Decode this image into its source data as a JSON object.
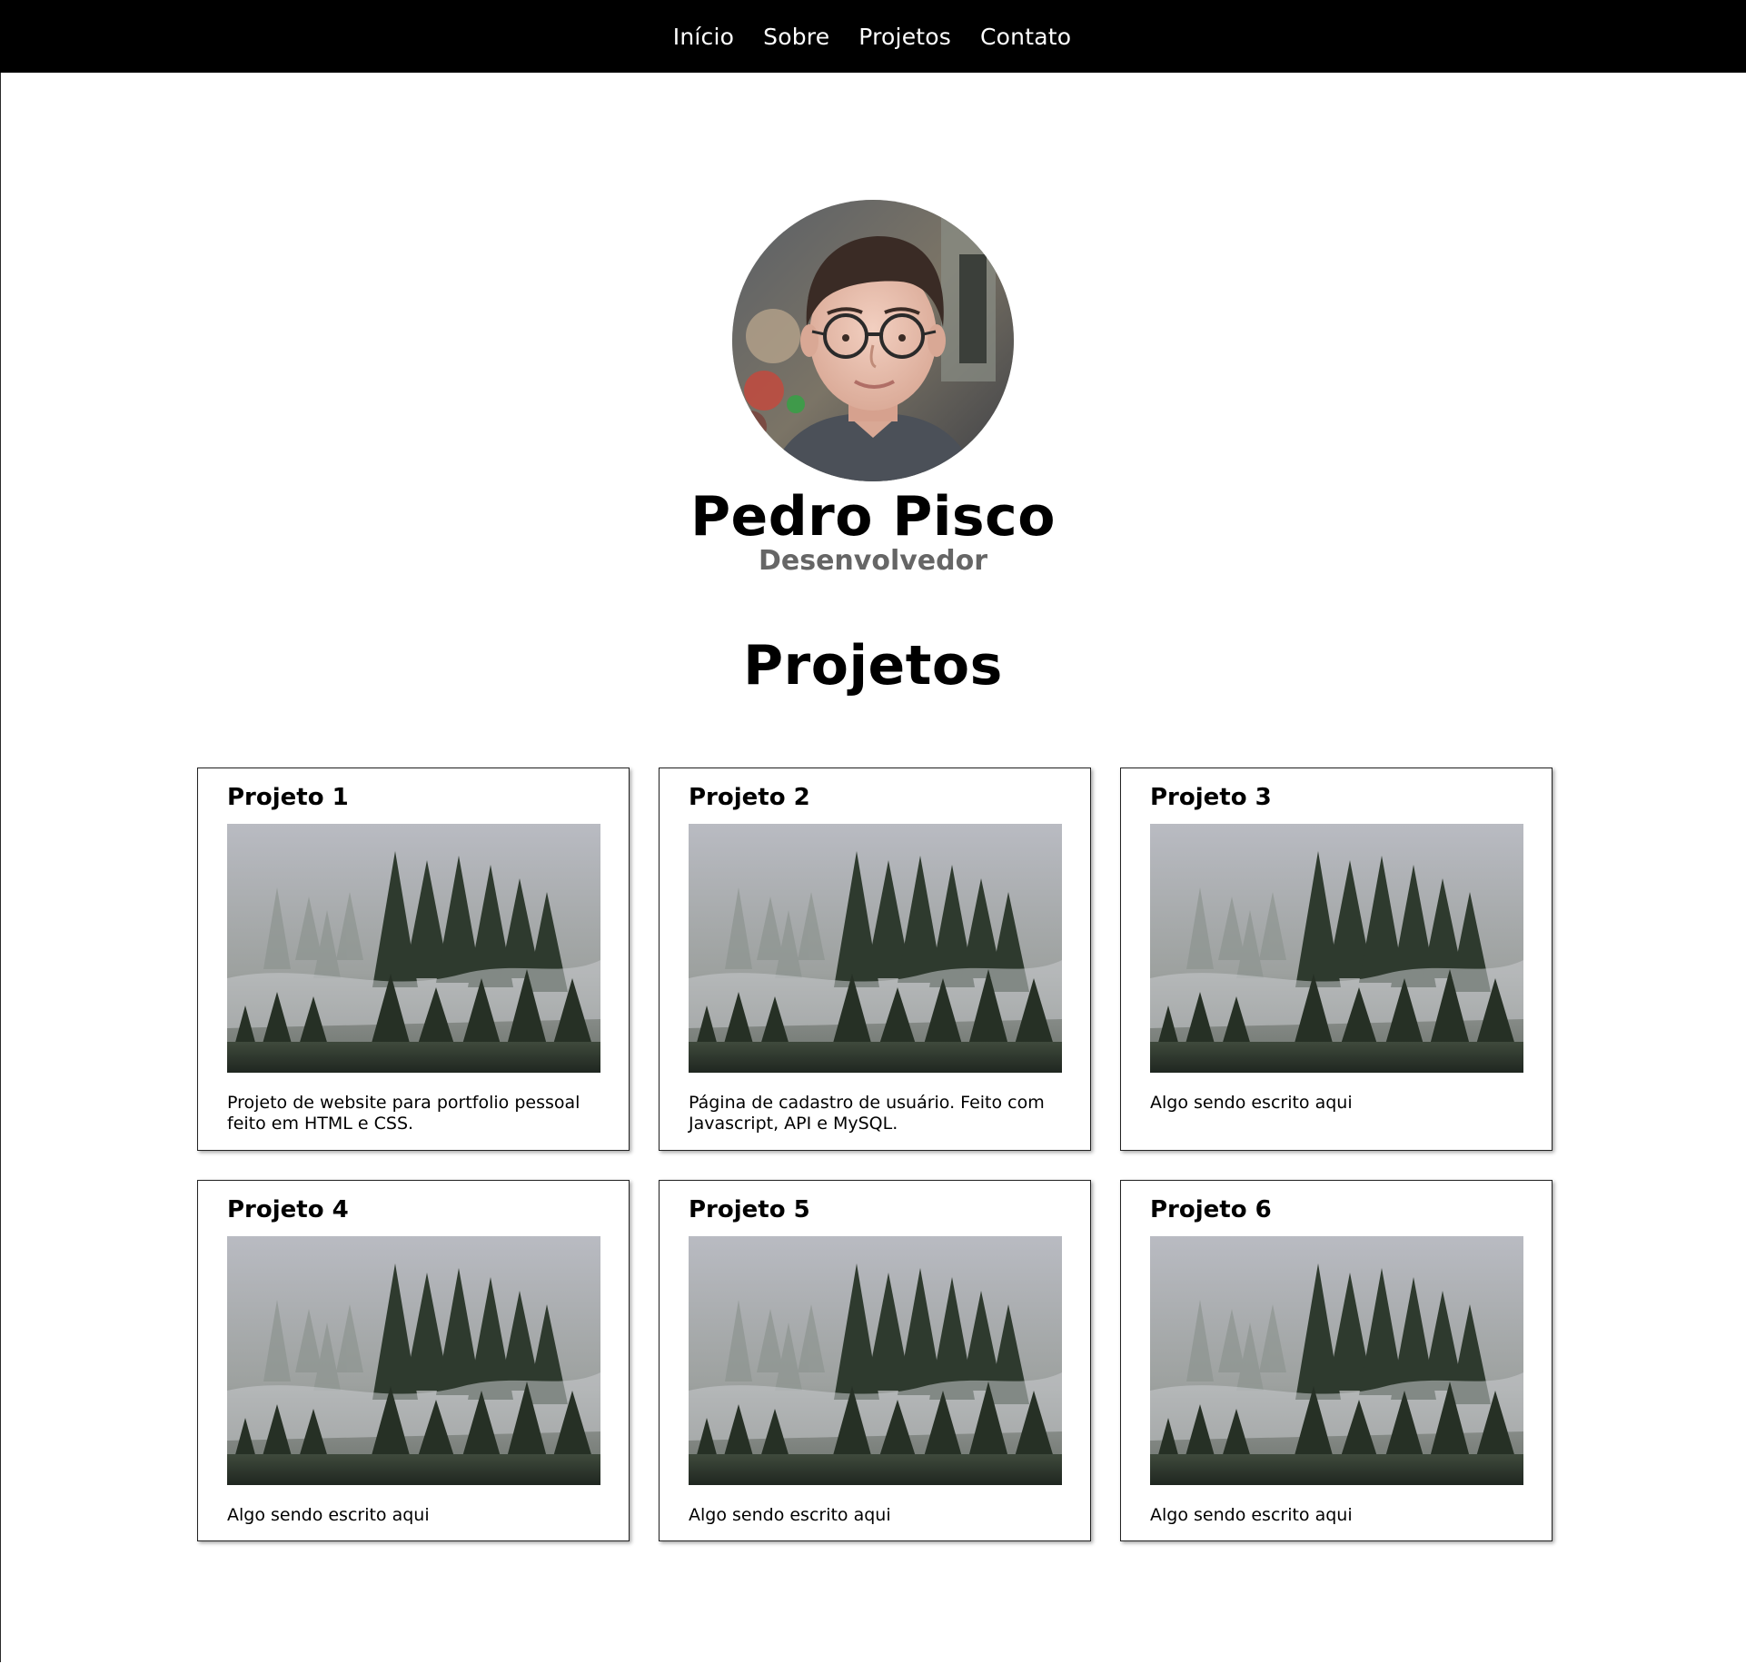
{
  "nav": {
    "items": [
      {
        "label": "Início"
      },
      {
        "label": "Sobre"
      },
      {
        "label": "Projetos"
      },
      {
        "label": "Contato"
      }
    ]
  },
  "profile": {
    "name": "Pedro Pisco",
    "role": "Desenvolvedor",
    "avatar_icon": "person-photo"
  },
  "projects_section": {
    "title": "Projetos",
    "items": [
      {
        "title": "Projeto 1",
        "description": "Projeto de website para portfolio pessoal feito em HTML e CSS.",
        "image": "misty-forest-photo"
      },
      {
        "title": "Projeto 2",
        "description": "Página de cadastro de usuário. Feito com Javascript, API e MySQL.",
        "image": "misty-forest-photo"
      },
      {
        "title": "Projeto 3",
        "description": "Algo sendo escrito aqui",
        "image": "misty-forest-photo"
      },
      {
        "title": "Projeto 4",
        "description": "Algo sendo escrito aqui",
        "image": "misty-forest-photo"
      },
      {
        "title": "Projeto 5",
        "description": "Algo sendo escrito aqui",
        "image": "misty-forest-photo"
      },
      {
        "title": "Projeto 6",
        "description": "Algo sendo escrito aqui",
        "image": "misty-forest-photo"
      }
    ]
  },
  "colors": {
    "nav_background": "#000000",
    "nav_text": "#ffffff",
    "role_text": "#666666"
  }
}
